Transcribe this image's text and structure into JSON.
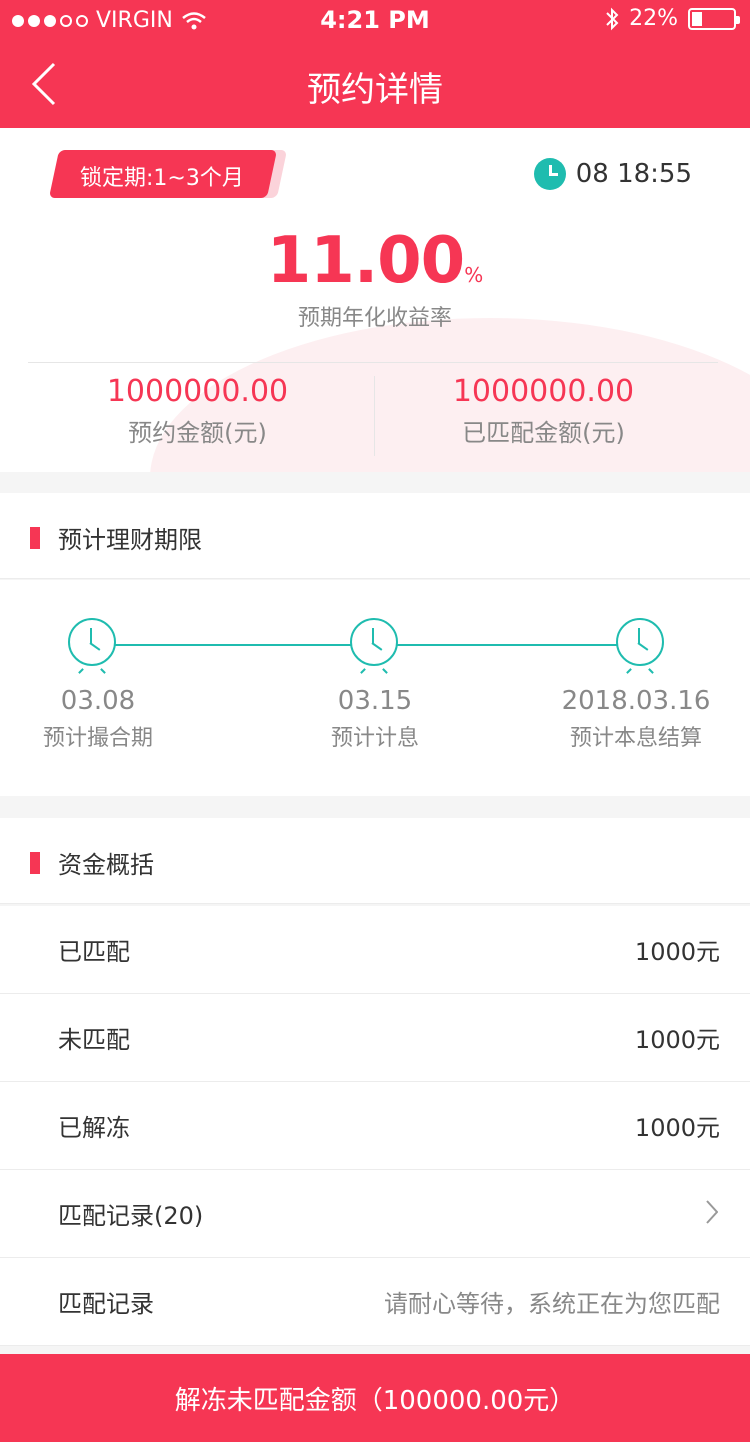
{
  "status": {
    "carrier": "VIRGIN",
    "time": "4:21 PM",
    "battery": "22%"
  },
  "nav": {
    "title": "预约详情"
  },
  "summary": {
    "tag": "锁定期:1~3个月",
    "time": "08 18:55",
    "rate_value": "11.00",
    "rate_unit": "%",
    "rate_label": "预期年化收益率",
    "amount_value": "1000000.00",
    "amount_label": "预约金额(元)",
    "matched_value": "1000000.00",
    "matched_label": "已匹配金额(元)"
  },
  "sections": {
    "term_title": "预计理财期限",
    "fund_title": "资金概括"
  },
  "timeline": [
    {
      "date": "03.08",
      "desc": "预计撮合期"
    },
    {
      "date": "03.15",
      "desc": "预计计息"
    },
    {
      "date": "2018.03.16",
      "desc": "预计本息结算"
    }
  ],
  "fund_rows": [
    {
      "label": "已匹配",
      "value": "1000元"
    },
    {
      "label": "未匹配",
      "value": "1000元"
    },
    {
      "label": "已解冻",
      "value": "1000元"
    },
    {
      "label": "匹配记录(20)",
      "value": ""
    },
    {
      "label": "匹配记录",
      "value": "请耐心等待，系统正在为您匹配"
    }
  ],
  "bottom_button": "解冻未匹配金额（100000.00元）",
  "colors": {
    "accent": "#f63654",
    "teal": "#1fbcaf"
  }
}
